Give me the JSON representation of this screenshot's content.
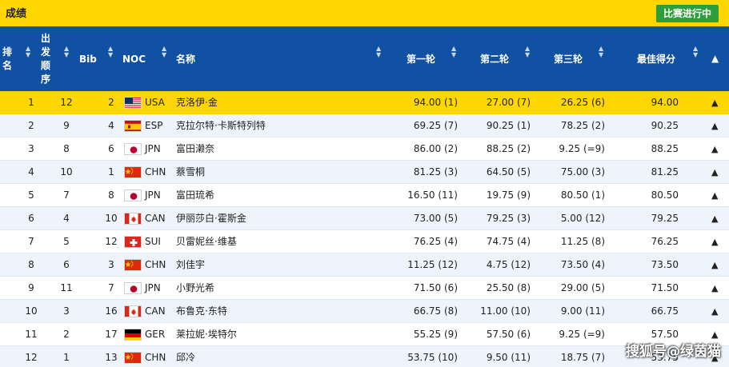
{
  "header": {
    "title": "成绩",
    "status_label": "比赛进行中"
  },
  "columns": {
    "rank": [
      "排",
      "名"
    ],
    "order": [
      "出",
      "发",
      "顺",
      "序"
    ],
    "bib": "Bib",
    "noc": "NOC",
    "name": "名称",
    "run1": "第一轮",
    "run2": "第二轮",
    "run3": "第三轮",
    "best": "最佳得分"
  },
  "rows": [
    {
      "rank": "1",
      "order": "12",
      "bib": "2",
      "noc": "USA",
      "name": "克洛伊·金",
      "run1": "94.00 (1)",
      "run2": "27.00 (7)",
      "run3": "26.25 (6)",
      "best": "94.00"
    },
    {
      "rank": "2",
      "order": "9",
      "bib": "4",
      "noc": "ESP",
      "name": "克拉尔特·卡斯特列特",
      "run1": "69.25 (7)",
      "run2": "90.25 (1)",
      "run3": "78.25 (2)",
      "best": "90.25"
    },
    {
      "rank": "3",
      "order": "8",
      "bib": "6",
      "noc": "JPN",
      "name": "富田濑奈",
      "run1": "86.00 (2)",
      "run2": "88.25 (2)",
      "run3": "9.25 (=9)",
      "best": "88.25"
    },
    {
      "rank": "4",
      "order": "10",
      "bib": "1",
      "noc": "CHN",
      "name": "蔡雪桐",
      "run1": "81.25 (3)",
      "run2": "64.50 (5)",
      "run3": "75.00 (3)",
      "best": "81.25"
    },
    {
      "rank": "5",
      "order": "7",
      "bib": "8",
      "noc": "JPN",
      "name": "富田琉希",
      "run1": "16.50 (11)",
      "run2": "19.75 (9)",
      "run3": "80.50 (1)",
      "best": "80.50"
    },
    {
      "rank": "6",
      "order": "4",
      "bib": "10",
      "noc": "CAN",
      "name": "伊丽莎白·霍斯金",
      "run1": "73.00 (5)",
      "run2": "79.25 (3)",
      "run3": "5.00 (12)",
      "best": "79.25"
    },
    {
      "rank": "7",
      "order": "5",
      "bib": "12",
      "noc": "SUI",
      "name": "贝雷妮丝·维基",
      "run1": "76.25 (4)",
      "run2": "74.75 (4)",
      "run3": "11.25 (8)",
      "best": "76.25"
    },
    {
      "rank": "8",
      "order": "6",
      "bib": "3",
      "noc": "CHN",
      "name": "刘佳宇",
      "run1": "11.25 (12)",
      "run2": "4.75 (12)",
      "run3": "73.50 (4)",
      "best": "73.50"
    },
    {
      "rank": "9",
      "order": "11",
      "bib": "7",
      "noc": "JPN",
      "name": "小野光希",
      "run1": "71.50 (6)",
      "run2": "25.50 (8)",
      "run3": "29.00 (5)",
      "best": "71.50"
    },
    {
      "rank": "10",
      "order": "3",
      "bib": "16",
      "noc": "CAN",
      "name": "布鲁克·东特",
      "run1": "66.75 (8)",
      "run2": "11.00 (10)",
      "run3": "9.00 (11)",
      "best": "66.75"
    },
    {
      "rank": "11",
      "order": "2",
      "bib": "17",
      "noc": "GER",
      "name": "莱拉妮·埃特尔",
      "run1": "55.25 (9)",
      "run2": "57.50 (6)",
      "run3": "9.25 (=9)",
      "best": "57.50"
    },
    {
      "rank": "12",
      "order": "1",
      "bib": "13",
      "noc": "CHN",
      "name": "邱冷",
      "run1": "53.75 (10)",
      "run2": "9.50 (11)",
      "run3": "18.75 (7)",
      "best": "53.75"
    }
  ],
  "watermark": "搜狐号@绿茵猫",
  "colors": {
    "header_yellow": "#ffd600",
    "table_header_blue": "#1051a4",
    "status_green": "#2e9e3a",
    "row_alt": "#eef4fb"
  }
}
